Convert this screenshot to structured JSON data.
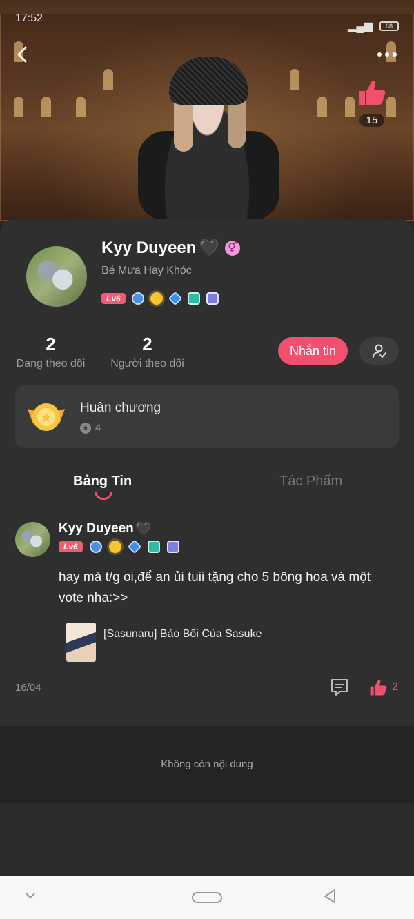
{
  "status_bar": {
    "time": "17:52",
    "battery": "68"
  },
  "header": {
    "likes": "15"
  },
  "profile": {
    "name": "Kyy Duyeen",
    "heart": "🖤",
    "gender_symbol": "⚥",
    "subtitle": "Bé Mưa Hay Khóc",
    "level": "Lv6"
  },
  "stats": [
    {
      "value": "2",
      "label": "Đang theo dõi"
    },
    {
      "value": "2",
      "label": "Người theo dõi"
    }
  ],
  "actions": {
    "message": "Nhắn tin"
  },
  "medals": {
    "title": "Huân chương",
    "count": "4"
  },
  "tabs": [
    {
      "label": "Bảng Tin"
    },
    {
      "label": "Tác Phẩm"
    }
  ],
  "post": {
    "author": "Kyy Duyeen",
    "heart": "🖤",
    "level": "Lv6",
    "text": "hay mà t/g oi,để an ủi tuii tặng cho 5 bông hoa và một vote nha:>>",
    "book_title": "[Sasunaru] Bảo Bối Của Sasuke",
    "date": "16/04",
    "likes": "2"
  },
  "footer": {
    "end_text": "Không còn nội dung"
  },
  "colors": {
    "accent": "#f0506e",
    "background": "#2f2f30",
    "card": "#3a3a3b"
  }
}
